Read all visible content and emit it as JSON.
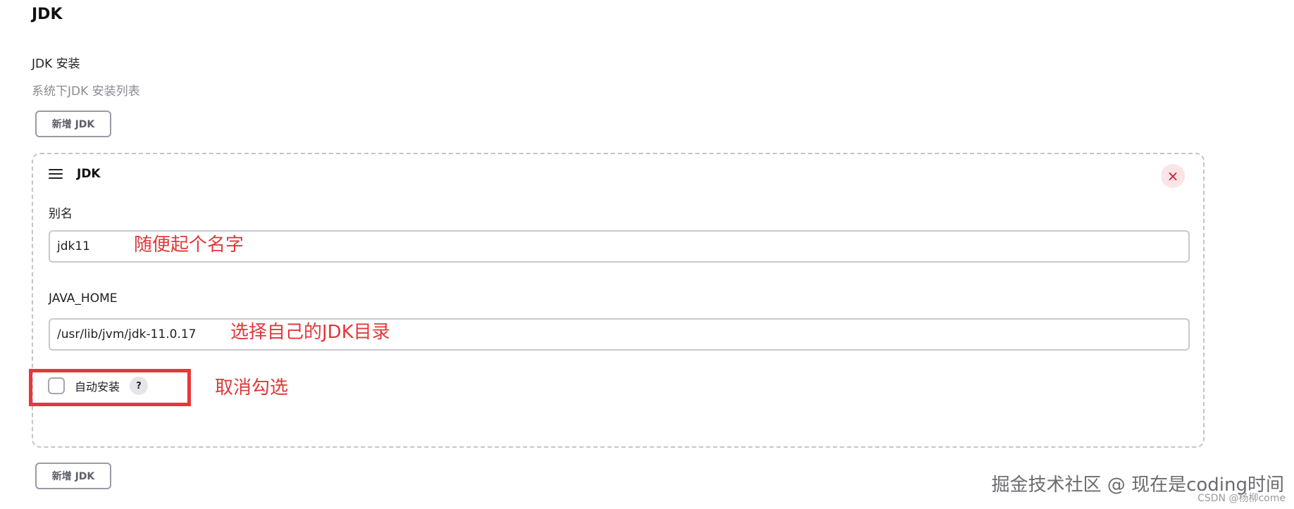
{
  "section": {
    "title": "JDK",
    "installations_label": "JDK 安装",
    "installations_description": "系统下JDK 安装列表",
    "add_button_label": "新增 JDK"
  },
  "jdk_entry": {
    "header_title": "JDK",
    "delete_symbol": "×",
    "alias_label": "别名",
    "alias_value": "jdk11",
    "java_home_label": "JAVA_HOME",
    "java_home_value": "/usr/lib/jvm/jdk-11.0.17",
    "auto_install_label": "自动安装",
    "auto_install_checked": false,
    "help_symbol": "?"
  },
  "annotations": {
    "alias_note": "随便起个名字",
    "java_home_note": "选择自己的JDK目录",
    "auto_install_note": "取消勾选",
    "highlight_color": "#e8363a"
  },
  "watermark": {
    "main": "掘金技术社区 @ 现在是coding时间",
    "sub": "CSDN @杨柳come"
  },
  "colors": {
    "delete_bg": "#fbe4e6",
    "delete_fg": "#d0142c",
    "annotation_text": "#e0383a"
  },
  "icons": {
    "drag_handle": "menu-lines-icon",
    "delete": "close-icon",
    "help": "question-icon"
  }
}
